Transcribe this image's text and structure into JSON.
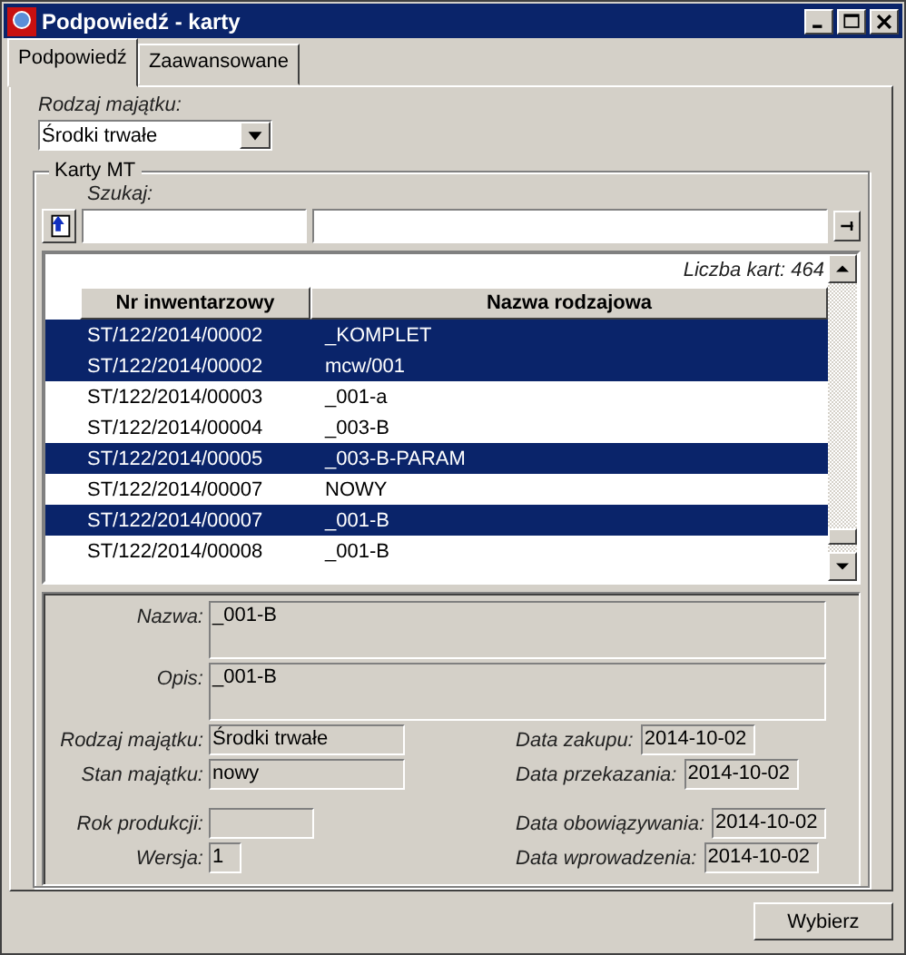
{
  "window": {
    "title": "Podpowiedź - karty"
  },
  "tabs": [
    {
      "label": "Podpowiedź",
      "selected": true
    },
    {
      "label": "Zaawansowane",
      "selected": false
    }
  ],
  "asset_type": {
    "label": "Rodzaj majątku:",
    "value": "Środki trwałe"
  },
  "cards": {
    "group_title": "Karty MT",
    "search_label": "Szukaj:",
    "count": "Liczba kart: 464",
    "columns": [
      "Nr inwentarzowy",
      "Nazwa rodzajowa"
    ],
    "rows": [
      {
        "cells": [
          "ST/122/2014/00002",
          "_KOMPLET"
        ],
        "selected": true
      },
      {
        "cells": [
          "ST/122/2014/00002",
          "mcw/001"
        ],
        "selected": true
      },
      {
        "cells": [
          "ST/122/2014/00003",
          "_001-a"
        ],
        "selected": false
      },
      {
        "cells": [
          "ST/122/2014/00004",
          "_003-B"
        ],
        "selected": false
      },
      {
        "cells": [
          "ST/122/2014/00005",
          "_003-B-PARAM"
        ],
        "selected": true
      },
      {
        "cells": [
          "ST/122/2014/00007",
          "NOWY"
        ],
        "selected": false
      },
      {
        "cells": [
          "ST/122/2014/00007",
          "_001-B"
        ],
        "selected": true
      },
      {
        "cells": [
          "ST/122/2014/00008",
          "_001-B"
        ],
        "selected": false
      }
    ]
  },
  "details": {
    "name": {
      "label": "Nazwa:",
      "value": "_001-B"
    },
    "description": {
      "label": "Opis:",
      "value": "_001-B"
    },
    "left": [
      {
        "label": "Rodzaj majątku:",
        "value": "Środki trwałe",
        "kind": "wide"
      },
      {
        "label": "Stan majątku:",
        "value": "nowy",
        "kind": "wide"
      },
      {
        "label": "Rok produkcji:",
        "kind": "short"
      },
      {
        "label": "Wersja:",
        "value": "1",
        "kind": "tiny"
      }
    ],
    "right": [
      {
        "label": "Data zakupu:",
        "value": "2014-10-02"
      },
      {
        "label": "Data przekazania:",
        "value": "2014-10-02"
      },
      {
        "label": "Data obowiązywania:",
        "value": "2014-10-02"
      },
      {
        "label": "Data wprowadzenia:",
        "value": "2014-10-02"
      }
    ]
  },
  "buttons": [
    "Wybierz"
  ]
}
